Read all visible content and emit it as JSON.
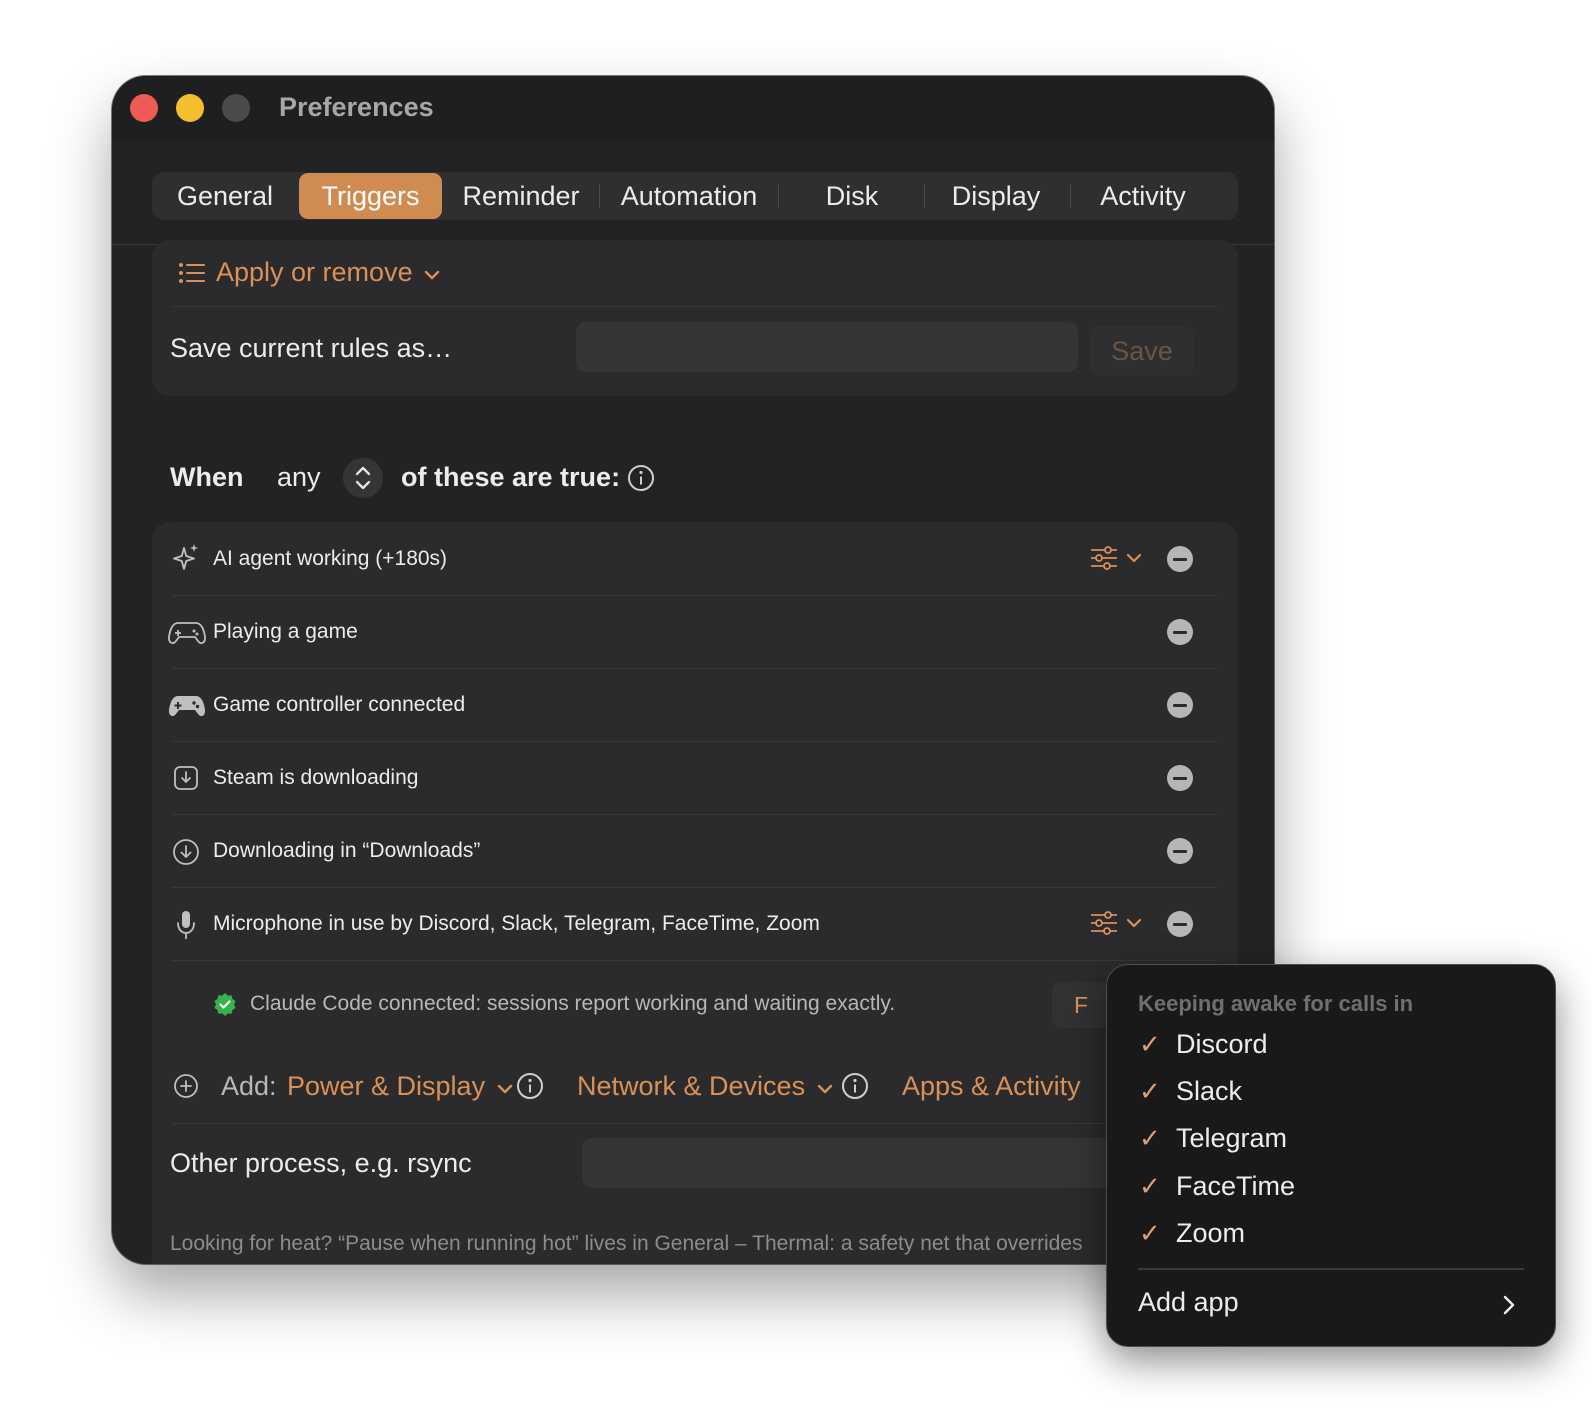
{
  "window": {
    "title": "Preferences"
  },
  "tabs": [
    "General",
    "Triggers",
    "Reminder",
    "Automation",
    "Disk",
    "Display",
    "Activity"
  ],
  "active_tab": "Triggers",
  "presets": {
    "apply_label": "Apply or remove",
    "save_rules_label": "Save current rules as…",
    "save_input_value": "",
    "save_button": "Save"
  },
  "condition": {
    "when": "When",
    "mode": "any",
    "suffix": "of these are true:"
  },
  "triggers": [
    {
      "label": "AI agent working (+180s)",
      "icon": "sparkles-icon",
      "has_options": true
    },
    {
      "label": "Playing a game",
      "icon": "gamepad-outline-icon",
      "has_options": false
    },
    {
      "label": "Game controller connected",
      "icon": "gamepad-filled-icon",
      "has_options": false
    },
    {
      "label": "Steam is downloading",
      "icon": "download-square-icon",
      "has_options": false
    },
    {
      "label": "Downloading in “Downloads”",
      "icon": "download-circle-icon",
      "has_options": false
    },
    {
      "label": "Microphone in use by Discord, Slack, Telegram, FaceTime, Zoom",
      "icon": "microphone-icon",
      "has_options": true
    }
  ],
  "status": {
    "text": "Claude Code connected: sessions report working and waiting exactly.",
    "button_partial": "F"
  },
  "add": {
    "label": "Add:",
    "menus": [
      "Power & Display",
      "Network & Devices",
      "Apps & Activity"
    ]
  },
  "other_process": {
    "label": "Other process, e.g. rsync",
    "value": ""
  },
  "footer_text": "Looking for heat? “Pause when running hot” lives in General – Thermal: a safety net that overrides",
  "popup": {
    "header": "Keeping awake for calls in",
    "apps": [
      "Discord",
      "Slack",
      "Telegram",
      "FaceTime",
      "Zoom"
    ],
    "add_app": "Add app"
  },
  "colors": {
    "accent": "#d08b52",
    "window_bg": "#232325",
    "card_bg": "#2b2b2d",
    "status_green": "#36b34a"
  }
}
